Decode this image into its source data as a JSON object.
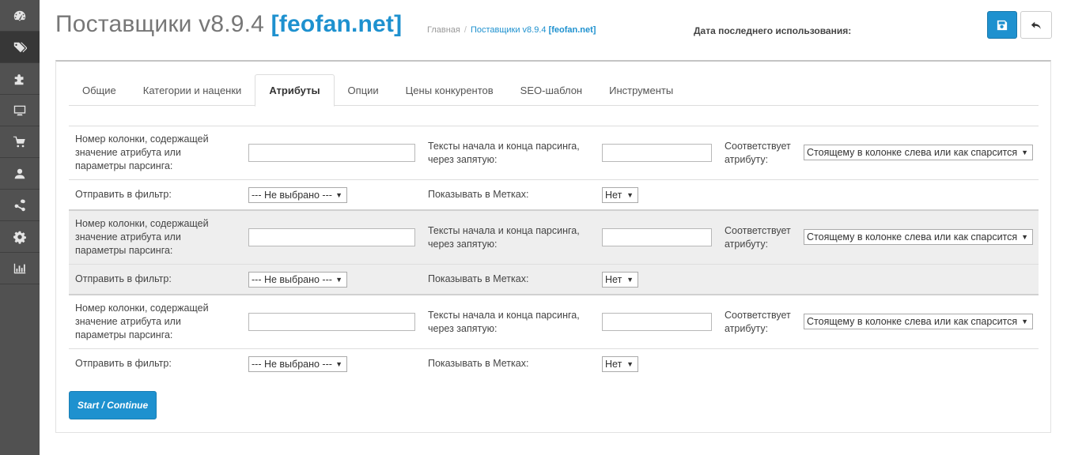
{
  "sidebar": {
    "items": [
      {
        "icon": "dashboard-icon",
        "active": false
      },
      {
        "icon": "tags-icon",
        "active": true
      },
      {
        "icon": "puzzle-icon",
        "active": false
      },
      {
        "icon": "desktop-icon",
        "active": false
      },
      {
        "icon": "cart-icon",
        "active": false
      },
      {
        "icon": "user-icon",
        "active": false
      },
      {
        "icon": "share-icon",
        "active": false
      },
      {
        "icon": "cog-icon",
        "active": false
      },
      {
        "icon": "bar-chart-icon",
        "active": false
      }
    ]
  },
  "header": {
    "title_prefix": "Поставщики v8.9.4 ",
    "title_brand": "[feofan.net]",
    "breadcrumb_home": "Главная",
    "breadcrumb_separator": "/",
    "breadcrumb_current_prefix": "Поставщики v8.9.4 ",
    "breadcrumb_current_brand": "[feofan.net]",
    "last_used_label": "Дата последнего использования:",
    "save_icon": "save-icon",
    "back_icon": "reply-icon"
  },
  "tabs": [
    {
      "label": "Общие",
      "active": false
    },
    {
      "label": "Категории и наценки",
      "active": false
    },
    {
      "label": "Атрибуты",
      "active": true
    },
    {
      "label": "Опции",
      "active": false
    },
    {
      "label": "Цены конкурентов",
      "active": false
    },
    {
      "label": "SEO-шаблон",
      "active": false
    },
    {
      "label": "Инструменты",
      "active": false
    }
  ],
  "labels": {
    "column_number_l1": "Номер колонки, содержащей",
    "column_number_l2": "значение атрибута или",
    "column_number_l3": "параметры парсинга:",
    "parse_texts_l1": "Тексты начала и конца парсинга,",
    "parse_texts_l2": "через запятую:",
    "corresponds_l1": "Соответствует",
    "corresponds_l2": "атрибуту:",
    "send_filter": "Отправить в фильтр:",
    "show_tags": "Показывать в Метках:"
  },
  "groups": [
    {
      "column_value": "",
      "parse_value": "",
      "attribute_selected": "Стоящему в колонке слева или как спарсится",
      "filter_selected": "--- Не выбрано ---",
      "tags_selected": "Нет",
      "shaded": false
    },
    {
      "column_value": "",
      "parse_value": "",
      "attribute_selected": "Стоящему в колонке слева или как спарсится",
      "filter_selected": "--- Не выбрано ---",
      "tags_selected": "Нет",
      "shaded": true
    },
    {
      "column_value": "",
      "parse_value": "",
      "attribute_selected": "Стоящему в колонке слева или как спарсится",
      "filter_selected": "--- Не выбрано ---",
      "tags_selected": "Нет",
      "shaded": false
    }
  ],
  "start_button": "Start / Continue",
  "colors": {
    "primary": "#1e91cf",
    "sidebar": "#515151",
    "sidebar_active": "#373737",
    "row_shade": "#eeeeee"
  }
}
